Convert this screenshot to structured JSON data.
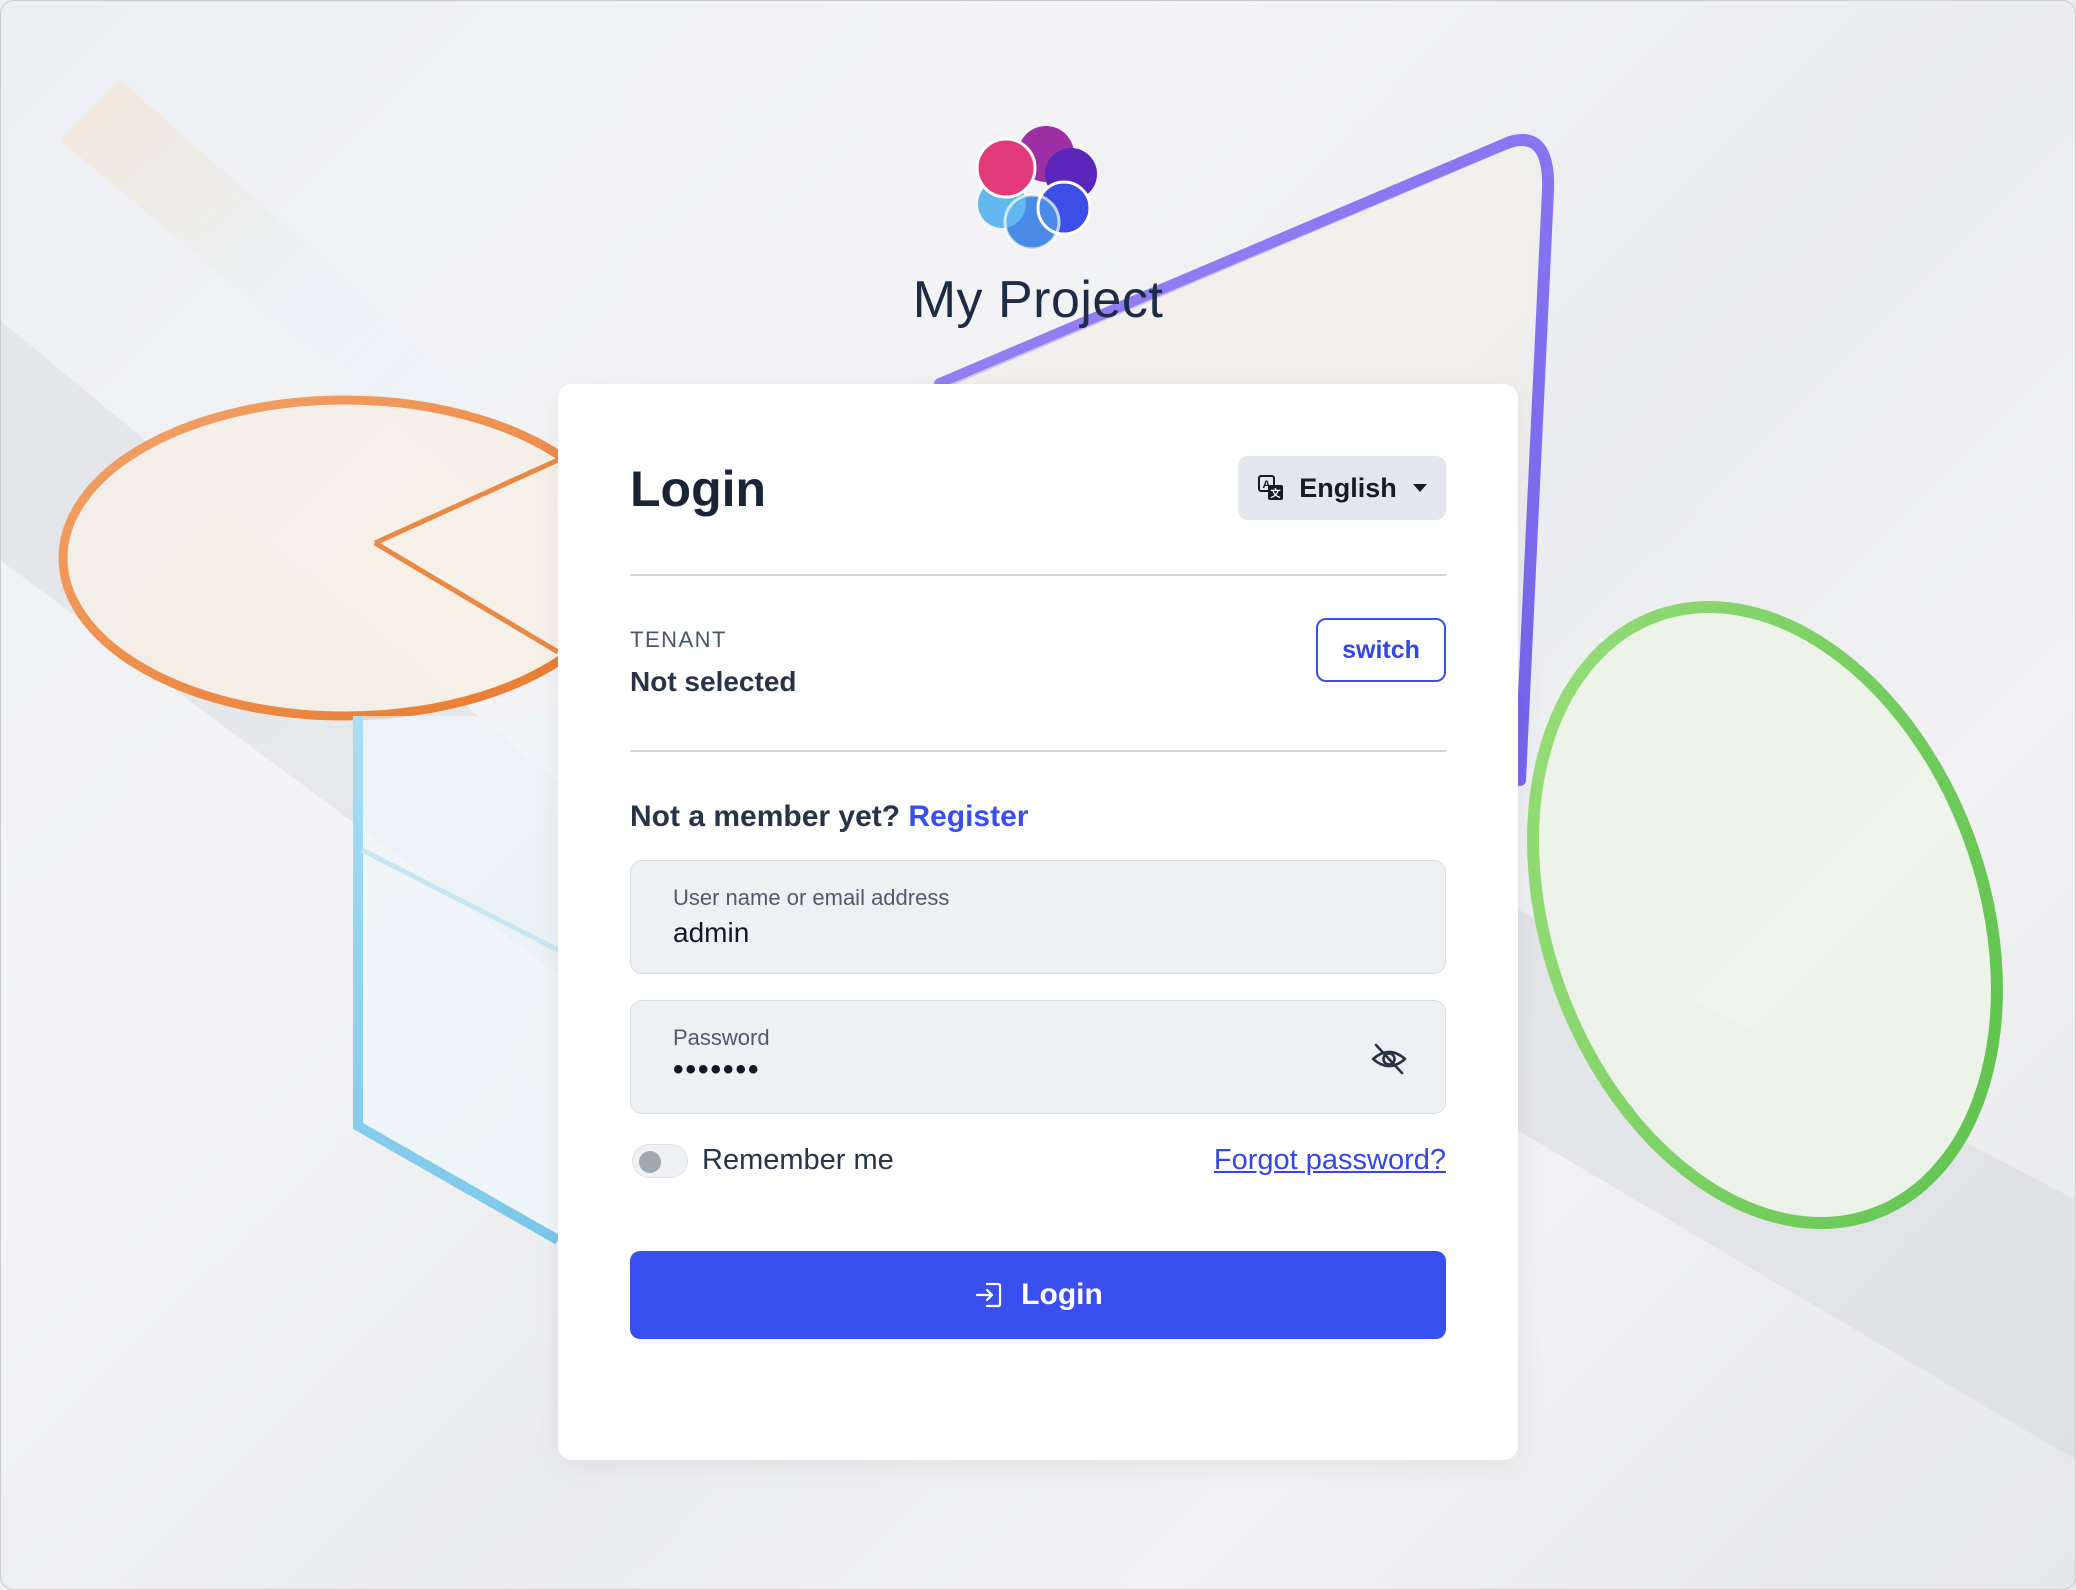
{
  "brand": {
    "title": "My Project",
    "logo_icon": "flower-logo-icon"
  },
  "login": {
    "heading": "Login",
    "language": {
      "selected": "English",
      "icon": "translate-icon"
    },
    "tenant": {
      "label": "TENANT",
      "value": "Not selected",
      "switch_label": "switch"
    },
    "register": {
      "prompt": "Not a member yet?",
      "link_label": "Register"
    },
    "username": {
      "label": "User name or email address",
      "value": "admin"
    },
    "password": {
      "label": "Password",
      "masked_value": "•••••••",
      "toggle_icon": "eye-slash-icon"
    },
    "remember_me": {
      "label": "Remember me",
      "checked": false
    },
    "forgot_password_label": "Forgot password?",
    "submit_label": "Login",
    "submit_icon": "sign-in-icon"
  },
  "colors": {
    "accent": "#3a4ff0",
    "link": "#3147e6",
    "text_dark": "#1b2437",
    "field_bg": "#eef1f4"
  }
}
